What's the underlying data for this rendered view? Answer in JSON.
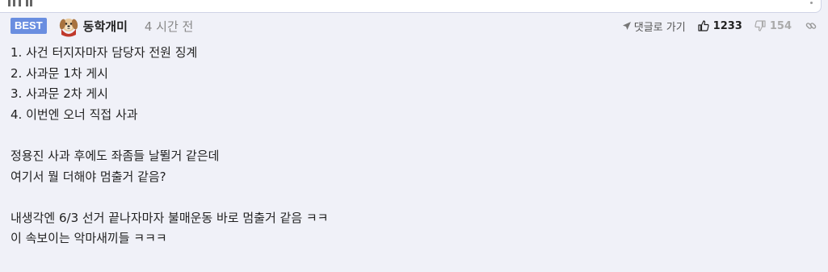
{
  "comment": {
    "badge": "BEST",
    "author": "동학개미",
    "time": "4 시간 전",
    "reply_label": "댓글로 가기",
    "upvotes": "1233",
    "downvotes": "154",
    "lines": [
      "1. 사건 터지자마자 담당자 전원 징계",
      "2. 사과문 1차 게시",
      "3. 사과문 2차 게시",
      "4. 이번엔 오너 직접 사과",
      "",
      "정용진 사과 후에도 좌좀들 날뛸거 같은데",
      "여기서 뭘 더해야 멈출거 같음?",
      "",
      "내생각엔 6/3 선거 끝나자마자 불매운동 바로 멈출거 같음 ㅋㅋ",
      "이 속보이는 악마새끼들 ㅋㅋㅋ"
    ]
  },
  "colors": {
    "badge_bg": "#6a8ee0",
    "page_bg": "#f0f1f8"
  },
  "icons": {
    "avatar": "dog-avatar-icon",
    "reply": "send-arrow-icon",
    "upvote": "thumbs-up-icon",
    "downvote": "thumbs-down-icon",
    "link": "link-icon"
  }
}
